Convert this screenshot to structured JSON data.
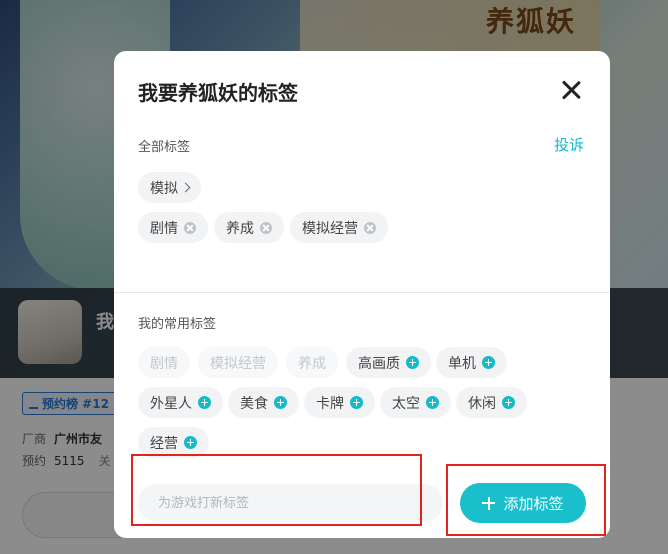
{
  "background": {
    "logo_text": "养狐妖",
    "game_title_partial": "我",
    "rank_badge": "预约榜 #12",
    "meta": {
      "vendor_label": "厂商",
      "vendor_value": "广州市友",
      "reserve_label": "预约",
      "reserve_value": "5115",
      "extra": "关"
    }
  },
  "modal": {
    "title": "我要养狐妖的标签",
    "all_tags_label": "全部标签",
    "report_label": "投诉",
    "all_tags": [
      {
        "label": "模拟",
        "kind": "expand"
      },
      {
        "label": "剧情",
        "kind": "removable"
      },
      {
        "label": "养成",
        "kind": "removable"
      },
      {
        "label": "模拟经营",
        "kind": "removable"
      }
    ],
    "common_tags_label": "我的常用标签",
    "common_tags": [
      {
        "label": "剧情",
        "state": "disabled"
      },
      {
        "label": "模拟经营",
        "state": "disabled"
      },
      {
        "label": "养成",
        "state": "disabled"
      },
      {
        "label": "高画质",
        "state": "addable"
      },
      {
        "label": "单机",
        "state": "addable"
      },
      {
        "label": "外星人",
        "state": "addable"
      },
      {
        "label": "美食",
        "state": "addable"
      },
      {
        "label": "卡牌",
        "state": "addable"
      },
      {
        "label": "太空",
        "state": "addable"
      },
      {
        "label": "休闲",
        "state": "addable"
      },
      {
        "label": "经营",
        "state": "addable"
      }
    ],
    "input_placeholder": "为游戏打新标签",
    "add_button_label": "添加标签"
  },
  "colors": {
    "accent": "#1abfcc",
    "annotation_red": "#e0251f"
  }
}
